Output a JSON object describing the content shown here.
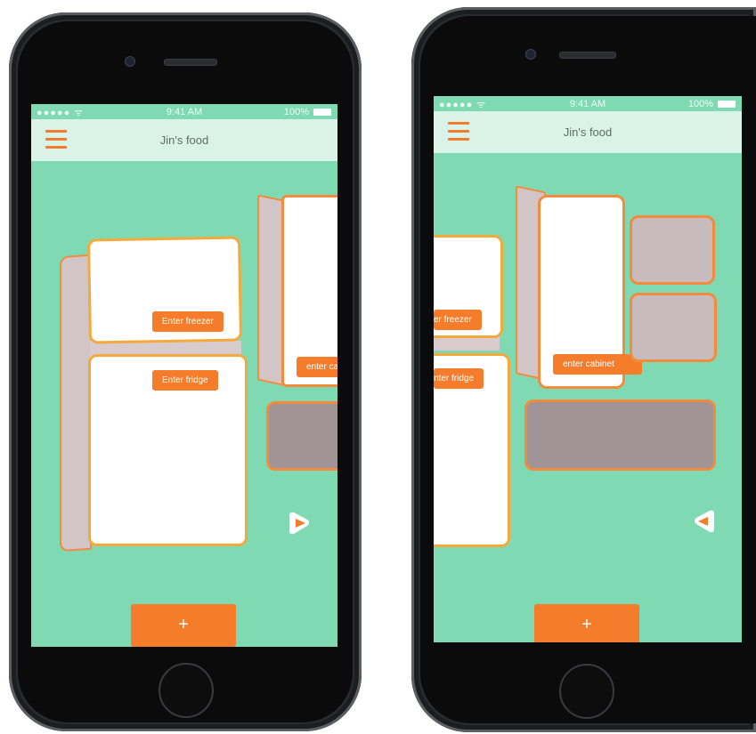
{
  "phones": [
    {
      "status": {
        "signal": "●●●●● ᯤ",
        "time": "9:41 AM",
        "battery": "100%"
      },
      "header": {
        "title": "Jin's food"
      },
      "buttons": {
        "freezer": "Enter freezer",
        "fridge": "Enter fridge",
        "cabinet": "enter ca",
        "add": "+"
      }
    },
    {
      "status": {
        "signal": "●●●●● ᯤ",
        "time": "9:41 AM",
        "battery": "100%"
      },
      "header": {
        "title": "Jin's food"
      },
      "buttons": {
        "freezer": "er freezer",
        "fridge": "nter fridge",
        "cabinet": "enter cabinet",
        "add": "+"
      }
    }
  ],
  "colors": {
    "screen": "#7fdab3",
    "accent": "#f57c2a",
    "navbar": "#daf3e8",
    "frame": "#2a2b2e"
  }
}
